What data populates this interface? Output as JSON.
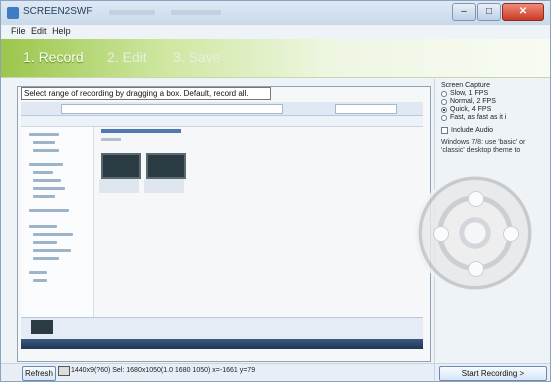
{
  "window": {
    "title": "SCREEN2SWF",
    "buttons": {
      "minimize": "–",
      "maximize": "□",
      "close": "✕"
    }
  },
  "menu": {
    "items": [
      "File",
      "Edit",
      "Help"
    ]
  },
  "steps": [
    {
      "label": "1. Record"
    },
    {
      "label": "2. Edit"
    },
    {
      "label": "3. Save"
    }
  ],
  "capture": {
    "hint": "Select range of recording by dragging a box. Default, record all."
  },
  "settings": {
    "title": "Screen Capture",
    "options": [
      {
        "label": "Slow, 1 FPS"
      },
      {
        "label": "Normal, 2 FPS"
      },
      {
        "label": "Quick, 4 FPS"
      },
      {
        "label": "Fast, as fast as it i"
      }
    ],
    "include_audio": "Include Audio",
    "tip": "Windows 7/8: use 'basic' or 'classic' desktop theme to"
  },
  "bottom": {
    "refresh": "Refresh",
    "coords": "1440x9(?60) Sel: 1680x1050(1.0 1680 1050) x=-1661 y=79",
    "start": "Start Recording >"
  }
}
